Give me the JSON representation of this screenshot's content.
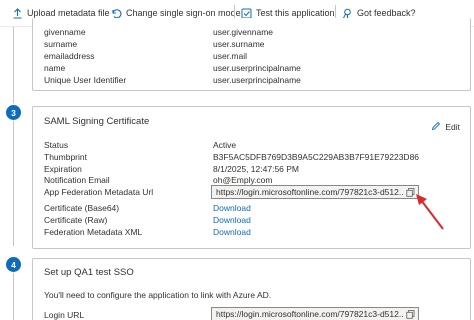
{
  "toolbar": {
    "upload_label": "Upload metadata file",
    "change_sso_label": "Change single sign-on mode",
    "test_label": "Test this application",
    "feedback_label": "Got feedback?"
  },
  "attributes": {
    "rows": [
      {
        "label": "givenname",
        "value": "user.givenname"
      },
      {
        "label": "surname",
        "value": "user.surname"
      },
      {
        "label": "emailaddress",
        "value": "user.mail"
      },
      {
        "label": "name",
        "value": "user.userprincipalname"
      },
      {
        "label": "Unique User Identifier",
        "value": "user.userprincipalname"
      }
    ]
  },
  "saml_cert": {
    "step": "3",
    "title": "SAML Signing Certificate",
    "edit_label": "Edit",
    "status_label": "Status",
    "status_value": "Active",
    "thumbprint_label": "Thumbprint",
    "thumbprint_value": "B3F5AC5DFB769D3B9A5C229AB3B7F91E79223D86",
    "expiration_label": "Expiration",
    "expiration_value": "8/1/2025, 12:47:56 PM",
    "notification_label": "Notification Email",
    "notification_value": "oh@Emply.com",
    "metadata_url_label": "App Federation Metadata Url",
    "metadata_url_value": "https://login.microsoftonline.com/797821c3-d512...",
    "cert_base64_label": "Certificate (Base64)",
    "cert_base64_link": "Download",
    "cert_raw_label": "Certificate (Raw)",
    "cert_raw_link": "Download",
    "fed_xml_label": "Federation Metadata XML",
    "fed_xml_link": "Download"
  },
  "setup": {
    "step": "4",
    "title": "Set up QA1 test SSO",
    "description": "You'll need to configure the application to link with Azure AD.",
    "login_url_label": "Login URL",
    "login_url_value": "https://login.microsoftonline.com/797821c3-d512..."
  },
  "colors": {
    "accent": "#0f6cbd",
    "annotation": "#d92b2b",
    "border": "#c8c6c4"
  }
}
